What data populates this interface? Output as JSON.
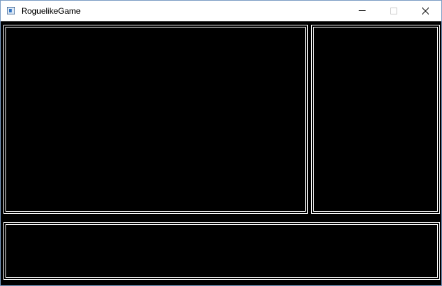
{
  "window": {
    "title": "RoguelikeGame",
    "icon": "app-window-icon",
    "controls": {
      "minimize_icon": "minimize-icon",
      "maximize_icon": "maximize-icon",
      "close_icon": "close-icon"
    }
  },
  "game": {
    "background_color": "#000000",
    "border_color": "#ffffff",
    "panels": [
      "map",
      "side",
      "log"
    ]
  }
}
